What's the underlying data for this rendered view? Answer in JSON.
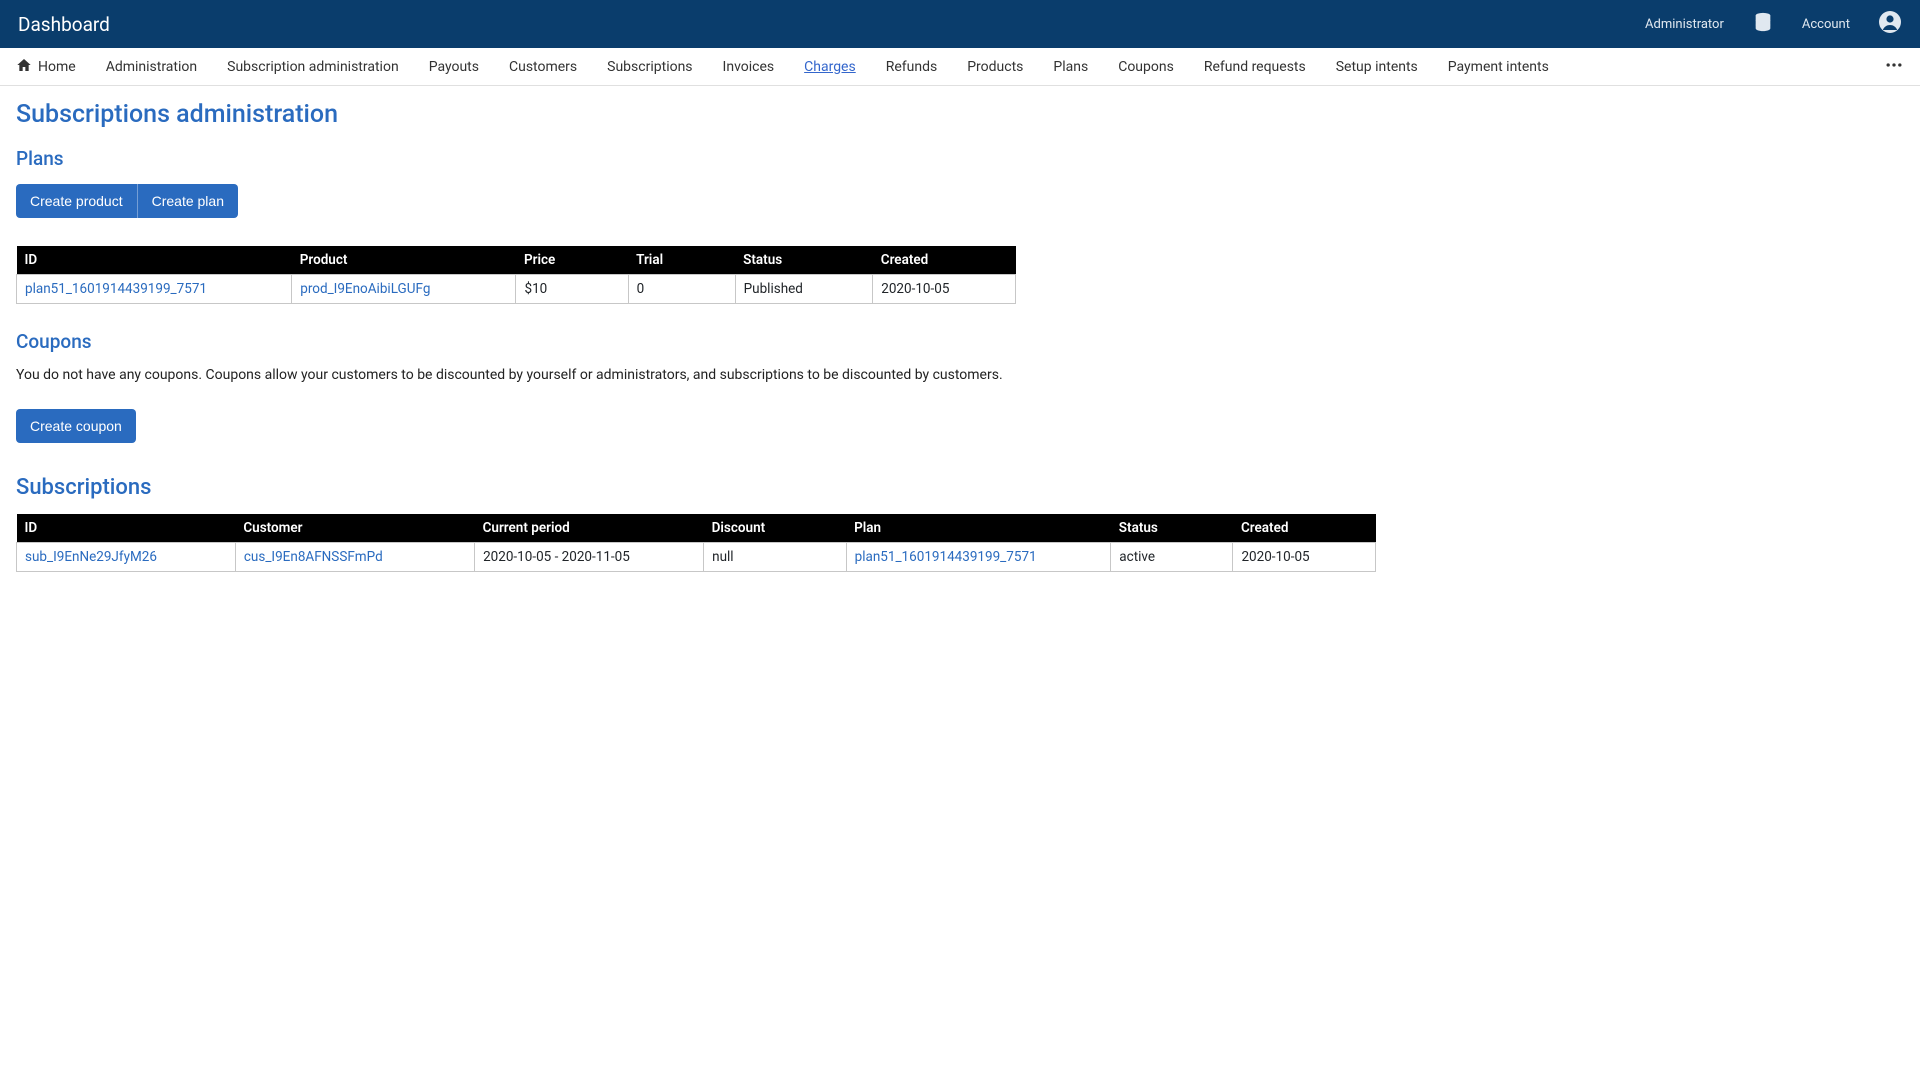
{
  "header": {
    "brand": "Dashboard",
    "admin_label": "Administrator",
    "account_label": "Account"
  },
  "nav": {
    "home": "Home",
    "items": [
      {
        "label": "Administration"
      },
      {
        "label": "Subscription administration"
      },
      {
        "label": "Payouts"
      },
      {
        "label": "Customers"
      },
      {
        "label": "Subscriptions"
      },
      {
        "label": "Invoices"
      },
      {
        "label": "Charges",
        "active": true
      },
      {
        "label": "Refunds"
      },
      {
        "label": "Products"
      },
      {
        "label": "Plans"
      },
      {
        "label": "Coupons"
      },
      {
        "label": "Refund requests"
      },
      {
        "label": "Setup intents"
      },
      {
        "label": "Payment intents"
      }
    ]
  },
  "page": {
    "title": "Subscriptions administration"
  },
  "plans": {
    "heading": "Plans",
    "create_product_label": "Create product",
    "create_plan_label": "Create plan",
    "columns": {
      "id": "ID",
      "product": "Product",
      "price": "Price",
      "trial": "Trial",
      "status": "Status",
      "created": "Created"
    },
    "rows": [
      {
        "id": "plan51_1601914439199_7571",
        "product": "prod_I9EnoAibiLGUFg",
        "price": "$10",
        "trial": "0",
        "status": "Published",
        "created": "2020-10-05"
      }
    ]
  },
  "coupons": {
    "heading": "Coupons",
    "empty_text": "You do not have any coupons. Coupons allow your customers to be discounted by yourself or administrators, and subscriptions to be discounted by customers.",
    "create_coupon_label": "Create coupon"
  },
  "subscriptions": {
    "heading": "Subscriptions",
    "columns": {
      "id": "ID",
      "customer": "Customer",
      "period": "Current period",
      "discount": "Discount",
      "plan": "Plan",
      "status": "Status",
      "created": "Created"
    },
    "rows": [
      {
        "id": "sub_I9EnNe29JfyM26",
        "customer": "cus_I9En8AFNSSFmPd",
        "period": "2020-10-05 - 2020-11-05",
        "discount": "null",
        "plan": "plan51_1601914439199_7571",
        "status": "active",
        "created": "2020-10-05"
      }
    ]
  }
}
